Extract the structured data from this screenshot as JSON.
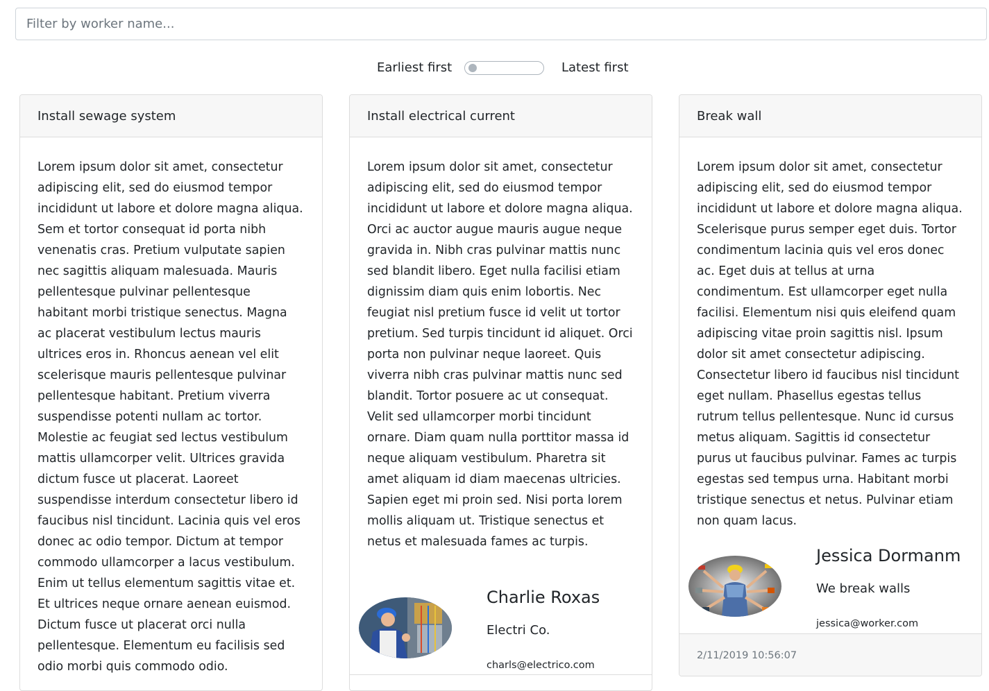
{
  "filter": {
    "placeholder": "Filter by worker name...",
    "value": ""
  },
  "sort": {
    "left_label": "Earliest first",
    "right_label": "Latest first",
    "latest_first": false
  },
  "cards": [
    {
      "title": "Install sewage system",
      "body": "Lorem ipsum dolor sit amet, consectetur adipiscing elit, sed do eiusmod tempor incididunt ut labore et dolore magna aliqua. Sem et tortor consequat id porta nibh venenatis cras. Pretium vulputate sapien nec sagittis aliquam malesuada. Mauris pellentesque pulvinar pellentesque habitant morbi tristique senectus. Magna ac placerat vestibulum lectus mauris ultrices eros in. Rhoncus aenean vel elit scelerisque mauris pellentesque pulvinar pellentesque habitant. Pretium viverra suspendisse potenti nullam ac tortor. Molestie ac feugiat sed lectus vestibulum mattis ullamcorper velit. Ultrices gravida dictum fusce ut placerat. Laoreet suspendisse interdum consectetur libero id faucibus nisl tincidunt. Lacinia quis vel eros donec ac odio tempor. Dictum at tempor commodo ullamcorper a lacus vestibulum. Enim ut tellus elementum sagittis vitae et. Et ultrices neque ornare aenean euismod. Dictum fusce ut placerat orci nulla pellentesque. Elementum eu facilisis sed odio morbi quis commodo odio."
    },
    {
      "title": "Install electrical current",
      "body": "Lorem ipsum dolor sit amet, consectetur adipiscing elit, sed do eiusmod tempor incididunt ut labore et dolore magna aliqua. Orci ac auctor augue mauris augue neque gravida in. Nibh cras pulvinar mattis nunc sed blandit libero. Eget nulla facilisi etiam dignissim diam quis enim lobortis. Nec feugiat nisl pretium fusce id velit ut tortor pretium. Sed turpis tincidunt id aliquet. Orci porta non pulvinar neque laoreet. Quis viverra nibh cras pulvinar mattis nunc sed blandit. Tortor posuere ac ut consequat. Velit sed ullamcorper morbi tincidunt ornare. Diam quam nulla porttitor massa id neque aliquam vestibulum. Pharetra sit amet aliquam id diam maecenas ultricies. Sapien eget mi proin sed. Nisi porta lorem mollis aliquam ut. Tristique senectus et netus et malesuada fames ac turpis.",
      "worker": {
        "name": "Charlie Roxas",
        "company": "Electri Co.",
        "email": "charls@electrico.com",
        "avatar_icon": "electrician-photo"
      }
    },
    {
      "title": "Break wall",
      "body": "Lorem ipsum dolor sit amet, consectetur adipiscing elit, sed do eiusmod tempor incididunt ut labore et dolore magna aliqua. Scelerisque purus semper eget duis. Tortor condimentum lacinia quis vel eros donec ac. Eget duis at tellus at urna condimentum. Est ullamcorper eget nulla facilisi. Elementum nisi quis eleifend quam adipiscing vitae proin sagittis nisl. Ipsum dolor sit amet consectetur adipiscing. Consectetur libero id faucibus nisl tincidunt eget nullam. Phasellus egestas tellus rutrum tellus pellentesque. Nunc id cursus metus aliquam. Sagittis id consectetur purus ut faucibus pulvinar. Fames ac turpis egestas sed tempus urna. Habitant morbi tristique senectus et netus. Pulvinar etiam non quam lacus.",
      "worker": {
        "name": "Jessica Dormanm",
        "company": "We break walls",
        "email": "jessica@worker.com",
        "avatar_icon": "multi-tool-worker-photo"
      },
      "footer_timestamp": "2/11/2019 10:56:07"
    }
  ]
}
